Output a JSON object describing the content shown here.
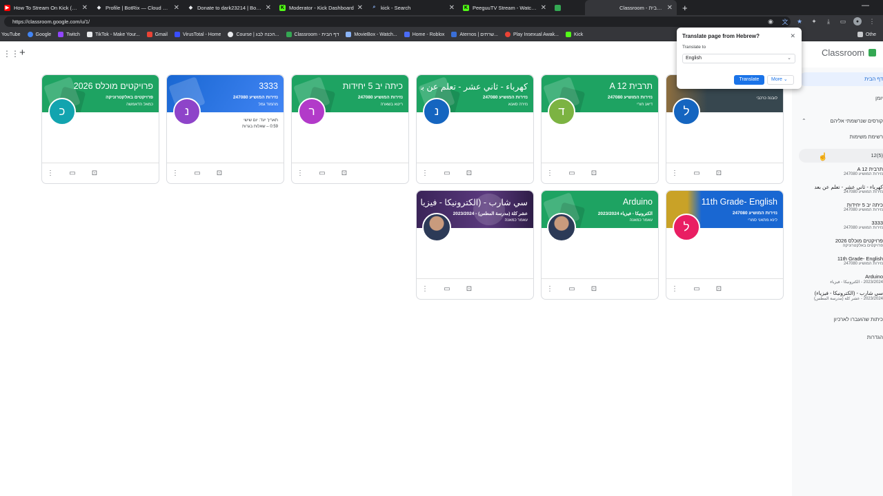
{
  "browser": {
    "tabs": [
      {
        "title": "How To Stream On Kick (For Begi...",
        "color": "#ff0000",
        "glyph": "▶"
      },
      {
        "title": "Profile | BotRix — Cloud Streaming...",
        "color": "#e8eaed",
        "glyph": "◆"
      },
      {
        "title": "Donate to dark23214 | BotRix — C...",
        "color": "#e8eaed",
        "glyph": "◆"
      },
      {
        "title": "Moderator - Kick Dashboard",
        "color": "#53fc18",
        "glyph": "K"
      },
      {
        "title": "kick - Search",
        "color": "#8ab4f8",
        "glyph": "⌕"
      },
      {
        "title": "PeeguuTV Stream - Watch Live on...",
        "color": "#53fc18",
        "glyph": "K"
      },
      {
        "title": "",
        "color": "#34a853",
        "glyph": ""
      },
      {
        "title": "Classroom - דף הבית",
        "color": "#34a853",
        "glyph": ""
      }
    ],
    "url": "https://classroom.google.com/u/1/",
    "bookmarks": [
      {
        "label": "YouTube",
        "color": "#ff0000"
      },
      {
        "label": "Google",
        "color": "#4285f4"
      },
      {
        "label": "Twitch",
        "color": "#9146ff"
      },
      {
        "label": "TikTok - Make Your...",
        "color": "#e8eaed"
      },
      {
        "label": "Gmail",
        "color": "#ea4335"
      },
      {
        "label": "VirusTotal - Home",
        "color": "#394eff"
      },
      {
        "label": "Course | הכנה לבג...",
        "color": "#e8eaed"
      },
      {
        "label": "Classroom - דף הבית",
        "color": "#34a853"
      },
      {
        "label": "MovieBox - Watch...",
        "color": "#8ab4f8"
      },
      {
        "label": "Home - Roblox",
        "color": "#4a6cf7"
      },
      {
        "label": "Aternos | שרתים...",
        "color": "#3a6fd8"
      },
      {
        "label": "Play Insexual Awak...",
        "color": "#ea4335"
      },
      {
        "label": "Kick",
        "color": "#53fc18"
      }
    ],
    "other_bookmarks": "Othe"
  },
  "translate_popup": {
    "title": "Translate page from Hebrew?",
    "label": "Translate to",
    "selected_language": "English",
    "translate_button": "Translate",
    "more_button": "More"
  },
  "app": {
    "brand": "Classroom"
  },
  "sidebar": {
    "home": "דף הבית",
    "calendar": "יומן",
    "enrolled_section": "קורסים שנרשמתי אליהם",
    "todo": "רשימת משימות",
    "hover_item": "(5)12",
    "courses": [
      {
        "name": "תרבית A 12",
        "sub": "נזירות המושיע 247080"
      },
      {
        "name": "كهرباء - ثاني عشر - تعلم عن بعد",
        "sub": "נזירות המושיע 247080"
      },
      {
        "name": "כיתה יב 5 יחידות",
        "sub": "נזירות המושיע 247080"
      },
      {
        "name": "3333",
        "sub": "נזירות המושיע 247080"
      },
      {
        "name": "פרויקטים מוכלס 2026",
        "sub": "פרויקטים באלקטרוניקה"
      },
      {
        "name": "11th Grade- English",
        "sub": "נזירות המושיע 247080"
      },
      {
        "name": "Arduino",
        "sub": "2023/2024 - الكترونيكا - فيزياء"
      },
      {
        "name": "سي شارب - (الكترونيكا - فيزياء)",
        "sub": "2023/2024 - عشر كلة (مدرسة المطس)"
      }
    ],
    "archived": "כיתות שהועברו לארכיון",
    "settings": "הגדרות"
  },
  "cards": [
    {
      "title": "פרויקטים מוכלס 2026",
      "subtitle": "פרויקטים באלקטרוניקה",
      "teacher": "כמאל הדאמשה",
      "letter": "כ",
      "banner": "#1ea362",
      "avatar": "#12a4af",
      "due": ""
    },
    {
      "title": "3333",
      "subtitle": "נזירות המושיע 247080",
      "teacher": "מהמוד גמל",
      "letter": "נ",
      "banner": "#1967d2",
      "avatar": "#8e44c9",
      "due": "תאריך יעד: יום שישי\n0:59 – שאלות בגרות"
    },
    {
      "title": "כיתה יב 5 יחידות",
      "subtitle": "נזירות המושיע 247080",
      "teacher": "ריטא בשארה",
      "letter": "ר",
      "banner": "#1ea362",
      "avatar": "#b23ac9",
      "due": ""
    },
    {
      "title": "كهرباء - ثاني عشر - تعلم عن بعد",
      "subtitle": "נזירות המושיע 247080",
      "teacher": "נזירה סאנא",
      "letter": "נ",
      "banner": "#1ea362",
      "avatar": "#1565c0",
      "due": ""
    },
    {
      "title": "תרבית A 12",
      "subtitle": "נזירות המושיע 247080",
      "teacher": "דיאנ חורי",
      "letter": "ד",
      "banner": "#1ea362",
      "avatar": "#7cb342",
      "due": ""
    },
    {
      "title": "",
      "subtitle": "",
      "teacher": "לובנה כרכבי",
      "letter": "ל",
      "banner": "#37474f",
      "avatar": "#1565c0",
      "due": ""
    },
    {
      "title": "سي شارب - (الكترونيكا - فيزياء)",
      "subtitle": "عشر كلة (مدرسة المطس) - 2023/2024",
      "teacher": "עאמר כמאנה",
      "letter": "",
      "banner": "#4a2f6e",
      "avatar": "",
      "due": ""
    },
    {
      "title": "Arduino",
      "subtitle": "الكترونيكا - فيزياء 2023/2024",
      "teacher": "עאמר כמאנה",
      "letter": "",
      "banner": "#1ea362",
      "avatar": "",
      "due": ""
    },
    {
      "title": "11th Grade- English",
      "subtitle": "נזירות המושיע 247080",
      "teacher": "לינא מתאני סמרי",
      "letter": "ל",
      "banner": "#1967d2",
      "avatar": "#e91e63",
      "due": ""
    }
  ]
}
